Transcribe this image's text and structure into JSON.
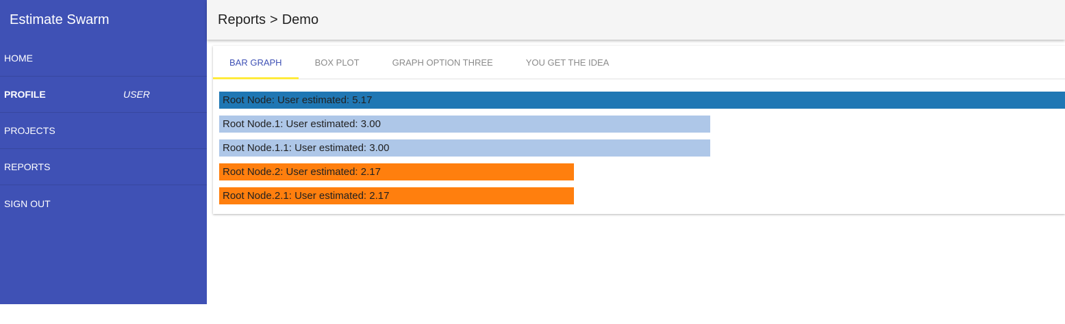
{
  "app": {
    "title": "Estimate Swarm"
  },
  "sidebar": {
    "items": [
      {
        "label": "HOME"
      },
      {
        "label": "PROFILE",
        "sub": "USER"
      },
      {
        "label": "PROJECTS"
      },
      {
        "label": "REPORTS"
      },
      {
        "label": "SIGN OUT"
      }
    ]
  },
  "header": {
    "breadcrumb": [
      "Reports",
      "Demo"
    ],
    "separator": ">"
  },
  "tabs": [
    {
      "label": "BAR GRAPH",
      "active": true
    },
    {
      "label": "BOX PLOT"
    },
    {
      "label": "GRAPH OPTION THREE"
    },
    {
      "label": "YOU GET THE IDEA"
    }
  ],
  "colors": {
    "sidebar": "#3f51b5",
    "tab_indicator": "#ffeb3b",
    "bar_root": "#1f77b4",
    "bar_branch1": "#aec7e8",
    "bar_branch2": "#ff7f0e"
  },
  "chart_data": {
    "type": "bar",
    "orientation": "horizontal",
    "bars": [
      {
        "label": "Root Node: User estimated: 5.17",
        "value": 5.17,
        "color": "#1f77b4"
      },
      {
        "label": "Root Node.1: User estimated: 3.00",
        "value": 3.0,
        "color": "#aec7e8"
      },
      {
        "label": "Root Node.1.1: User estimated: 3.00",
        "value": 3.0,
        "color": "#aec7e8"
      },
      {
        "label": "Root Node.2: User estimated: 2.17",
        "value": 2.17,
        "color": "#ff7f0e"
      },
      {
        "label": "Root Node.2.1: User estimated: 2.17",
        "value": 2.17,
        "color": "#ff7f0e"
      }
    ]
  }
}
